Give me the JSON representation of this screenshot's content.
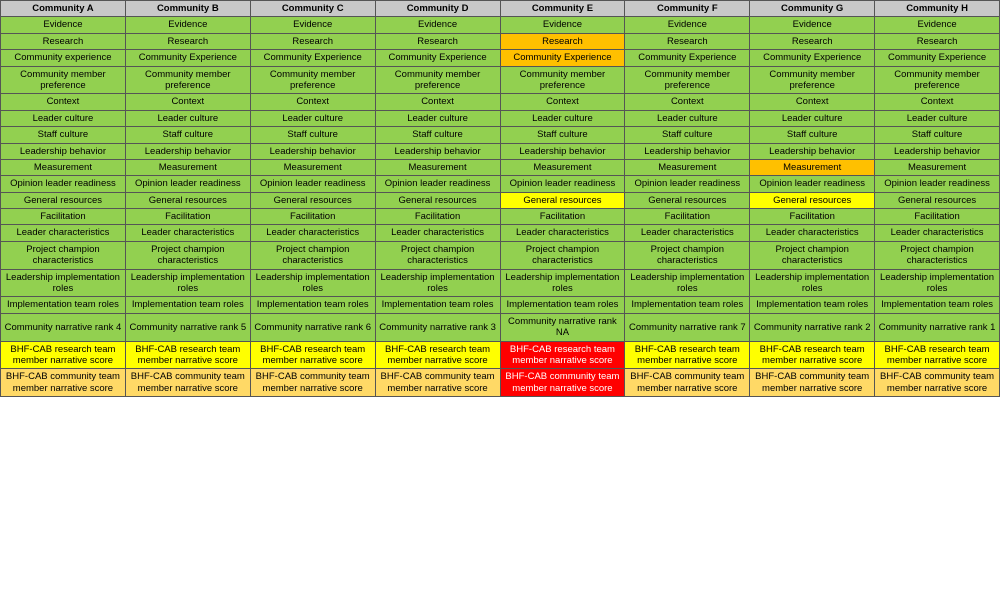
{
  "communities": [
    "Community A",
    "Community B",
    "Community C",
    "Community D",
    "Community E",
    "Community F",
    "Community G",
    "Community H"
  ],
  "rows": [
    {
      "label": "Evidence",
      "cells": [
        {
          "text": "Evidence",
          "color": "green"
        },
        {
          "text": "Evidence",
          "color": "green"
        },
        {
          "text": "Evidence",
          "color": "green"
        },
        {
          "text": "Evidence",
          "color": "green"
        },
        {
          "text": "Evidence",
          "color": "green"
        },
        {
          "text": "Evidence",
          "color": "green"
        },
        {
          "text": "Evidence",
          "color": "green"
        },
        {
          "text": "Evidence",
          "color": "green"
        }
      ]
    },
    {
      "label": "Research",
      "cells": [
        {
          "text": "Research",
          "color": "green"
        },
        {
          "text": "Research",
          "color": "green"
        },
        {
          "text": "Research",
          "color": "green"
        },
        {
          "text": "Research",
          "color": "green"
        },
        {
          "text": "Research",
          "color": "orange"
        },
        {
          "text": "Research",
          "color": "green"
        },
        {
          "text": "Research",
          "color": "green"
        },
        {
          "text": "Research",
          "color": "green"
        }
      ]
    },
    {
      "label": "Community experience",
      "cells": [
        {
          "text": "Community experience",
          "color": "green"
        },
        {
          "text": "Community Experience",
          "color": "green"
        },
        {
          "text": "Community Experience",
          "color": "green"
        },
        {
          "text": "Community Experience",
          "color": "green"
        },
        {
          "text": "Community Experience",
          "color": "orange"
        },
        {
          "text": "Community Experience",
          "color": "green"
        },
        {
          "text": "Community Experience",
          "color": "green"
        },
        {
          "text": "Community Experience",
          "color": "green"
        }
      ]
    },
    {
      "label": "Community member preference",
      "cells": [
        {
          "text": "Community member preference",
          "color": "green"
        },
        {
          "text": "Community member preference",
          "color": "green"
        },
        {
          "text": "Community member preference",
          "color": "green"
        },
        {
          "text": "Community member preference",
          "color": "green"
        },
        {
          "text": "Community member preference",
          "color": "green"
        },
        {
          "text": "Community member preference",
          "color": "green"
        },
        {
          "text": "Community member preference",
          "color": "green"
        },
        {
          "text": "Community member preference",
          "color": "green"
        }
      ]
    },
    {
      "label": "Context",
      "cells": [
        {
          "text": "Context",
          "color": "green"
        },
        {
          "text": "Context",
          "color": "green"
        },
        {
          "text": "Context",
          "color": "green"
        },
        {
          "text": "Context",
          "color": "green"
        },
        {
          "text": "Context",
          "color": "green"
        },
        {
          "text": "Context",
          "color": "green"
        },
        {
          "text": "Context",
          "color": "green"
        },
        {
          "text": "Context",
          "color": "green"
        }
      ]
    },
    {
      "label": "Leader culture",
      "cells": [
        {
          "text": "Leader culture",
          "color": "green"
        },
        {
          "text": "Leader culture",
          "color": "green"
        },
        {
          "text": "Leader culture",
          "color": "green"
        },
        {
          "text": "Leader culture",
          "color": "green"
        },
        {
          "text": "Leader culture",
          "color": "green"
        },
        {
          "text": "Leader culture",
          "color": "green"
        },
        {
          "text": "Leader culture",
          "color": "green"
        },
        {
          "text": "Leader culture",
          "color": "green"
        }
      ]
    },
    {
      "label": "Staff culture",
      "cells": [
        {
          "text": "Staff culture",
          "color": "green"
        },
        {
          "text": "Staff culture",
          "color": "green"
        },
        {
          "text": "Staff culture",
          "color": "green"
        },
        {
          "text": "Staff culture",
          "color": "green"
        },
        {
          "text": "Staff culture",
          "color": "green"
        },
        {
          "text": "Staff culture",
          "color": "green"
        },
        {
          "text": "Staff culture",
          "color": "green"
        },
        {
          "text": "Staff culture",
          "color": "green"
        }
      ]
    },
    {
      "label": "Leadership behavior",
      "cells": [
        {
          "text": "Leadership behavior",
          "color": "green"
        },
        {
          "text": "Leadership behavior",
          "color": "green"
        },
        {
          "text": "Leadership behavior",
          "color": "green"
        },
        {
          "text": "Leadership behavior",
          "color": "green"
        },
        {
          "text": "Leadership behavior",
          "color": "green"
        },
        {
          "text": "Leadership behavior",
          "color": "green"
        },
        {
          "text": "Leadership behavior",
          "color": "green"
        },
        {
          "text": "Leadership behavior",
          "color": "green"
        }
      ]
    },
    {
      "label": "Measurement",
      "cells": [
        {
          "text": "Measurement",
          "color": "green"
        },
        {
          "text": "Measurement",
          "color": "green"
        },
        {
          "text": "Measurement",
          "color": "green"
        },
        {
          "text": "Measurement",
          "color": "green"
        },
        {
          "text": "Measurement",
          "color": "green"
        },
        {
          "text": "Measurement",
          "color": "green"
        },
        {
          "text": "Measurement",
          "color": "orange"
        },
        {
          "text": "Measurement",
          "color": "green"
        }
      ]
    },
    {
      "label": "Opinion leader readiness",
      "cells": [
        {
          "text": "Opinion leader readiness",
          "color": "green"
        },
        {
          "text": "Opinion leader readiness",
          "color": "green"
        },
        {
          "text": "Opinion leader readiness",
          "color": "green"
        },
        {
          "text": "Opinion leader readiness",
          "color": "green"
        },
        {
          "text": "Opinion leader readiness",
          "color": "green"
        },
        {
          "text": "Opinion leader readiness",
          "color": "green"
        },
        {
          "text": "Opinion leader readiness",
          "color": "green"
        },
        {
          "text": "Opinion leader readiness",
          "color": "green"
        }
      ]
    },
    {
      "label": "General resources",
      "cells": [
        {
          "text": "General resources",
          "color": "green"
        },
        {
          "text": "General resources",
          "color": "green"
        },
        {
          "text": "General resources",
          "color": "green"
        },
        {
          "text": "General resources",
          "color": "green"
        },
        {
          "text": "General resources",
          "color": "yellow"
        },
        {
          "text": "General resources",
          "color": "green"
        },
        {
          "text": "General resources",
          "color": "yellow"
        },
        {
          "text": "General resources",
          "color": "green"
        }
      ]
    },
    {
      "label": "Facilitation",
      "cells": [
        {
          "text": "Facilitation",
          "color": "green"
        },
        {
          "text": "Facilitation",
          "color": "green"
        },
        {
          "text": "Facilitation",
          "color": "green"
        },
        {
          "text": "Facilitation",
          "color": "green"
        },
        {
          "text": "Facilitation",
          "color": "green"
        },
        {
          "text": "Facilitation",
          "color": "green"
        },
        {
          "text": "Facilitation",
          "color": "green"
        },
        {
          "text": "Facilitation",
          "color": "green"
        }
      ]
    },
    {
      "label": "Leader characteristics",
      "cells": [
        {
          "text": "Leader characteristics",
          "color": "green"
        },
        {
          "text": "Leader characteristics",
          "color": "green"
        },
        {
          "text": "Leader characteristics",
          "color": "green"
        },
        {
          "text": "Leader characteristics",
          "color": "green"
        },
        {
          "text": "Leader characteristics",
          "color": "green"
        },
        {
          "text": "Leader characteristics",
          "color": "green"
        },
        {
          "text": "Leader characteristics",
          "color": "green"
        },
        {
          "text": "Leader characteristics",
          "color": "green"
        }
      ]
    },
    {
      "label": "Project champion characteristics",
      "cells": [
        {
          "text": "Project champion characteristics",
          "color": "green"
        },
        {
          "text": "Project champion characteristics",
          "color": "green"
        },
        {
          "text": "Project champion characteristics",
          "color": "green"
        },
        {
          "text": "Project champion characteristics",
          "color": "green"
        },
        {
          "text": "Project champion characteristics",
          "color": "green"
        },
        {
          "text": "Project champion characteristics",
          "color": "green"
        },
        {
          "text": "Project champion characteristics",
          "color": "green"
        },
        {
          "text": "Project champion characteristics",
          "color": "green"
        }
      ]
    },
    {
      "label": "Leadership implementation roles",
      "cells": [
        {
          "text": "Leadership implementation roles",
          "color": "green"
        },
        {
          "text": "Leadership implementation roles",
          "color": "green"
        },
        {
          "text": "Leadership implementation roles",
          "color": "green"
        },
        {
          "text": "Leadership implementation roles",
          "color": "green"
        },
        {
          "text": "Leadership implementation roles",
          "color": "green"
        },
        {
          "text": "Leadership implementation roles",
          "color": "green"
        },
        {
          "text": "Leadership implementation roles",
          "color": "green"
        },
        {
          "text": "Leadership implementation roles",
          "color": "green"
        }
      ]
    },
    {
      "label": "Implementation team roles",
      "cells": [
        {
          "text": "Implementation team roles",
          "color": "green"
        },
        {
          "text": "Implementation team roles",
          "color": "green"
        },
        {
          "text": "Implementation team roles",
          "color": "green"
        },
        {
          "text": "Implementation team roles",
          "color": "green"
        },
        {
          "text": "Implementation team roles",
          "color": "green"
        },
        {
          "text": "Implementation team roles",
          "color": "green"
        },
        {
          "text": "Implementation team roles",
          "color": "green"
        },
        {
          "text": "Implementation team roles",
          "color": "green"
        }
      ]
    },
    {
      "label": "Community narrative rank",
      "cells": [
        {
          "text": "Community narrative rank 4",
          "color": "green"
        },
        {
          "text": "Community narrative rank 5",
          "color": "green"
        },
        {
          "text": "Community narrative rank 6",
          "color": "green"
        },
        {
          "text": "Community narrative rank 3",
          "color": "green"
        },
        {
          "text": "Community narrative rank NA",
          "color": "green"
        },
        {
          "text": "Community narrative rank 7",
          "color": "green"
        },
        {
          "text": "Community narrative rank 2",
          "color": "green"
        },
        {
          "text": "Community narrative rank 1",
          "color": "green"
        }
      ]
    },
    {
      "label": "BHF-CAB research team member narrative score",
      "cells": [
        {
          "text": "BHF-CAB research team member narrative score",
          "color": "yellow"
        },
        {
          "text": "BHF-CAB research team member narrative score",
          "color": "yellow"
        },
        {
          "text": "BHF-CAB research team member narrative score",
          "color": "yellow"
        },
        {
          "text": "BHF-CAB research team member narrative score",
          "color": "yellow"
        },
        {
          "text": "BHF-CAB research team member narrative score",
          "color": "red"
        },
        {
          "text": "BHF-CAB research team member narrative score",
          "color": "yellow"
        },
        {
          "text": "BHF-CAB research team member narrative score",
          "color": "yellow"
        },
        {
          "text": "BHF-CAB research team member narrative score",
          "color": "yellow"
        }
      ]
    },
    {
      "label": "BHF-CAB community team member narrative score",
      "cells": [
        {
          "text": "BHF-CAB community team member narrative score",
          "color": "dark-yellow"
        },
        {
          "text": "BHF-CAB community team member narrative score",
          "color": "dark-yellow"
        },
        {
          "text": "BHF-CAB community team member narrative score",
          "color": "dark-yellow"
        },
        {
          "text": "BHF-CAB community team member narrative score",
          "color": "dark-yellow"
        },
        {
          "text": "BHF-CAB community team member narrative score",
          "color": "red"
        },
        {
          "text": "BHF-CAB community team member narrative score",
          "color": "dark-yellow"
        },
        {
          "text": "BHF-CAB community team member narrative score",
          "color": "dark-yellow"
        },
        {
          "text": "BHF-CAB community team member narrative score",
          "color": "dark-yellow"
        }
      ]
    }
  ]
}
